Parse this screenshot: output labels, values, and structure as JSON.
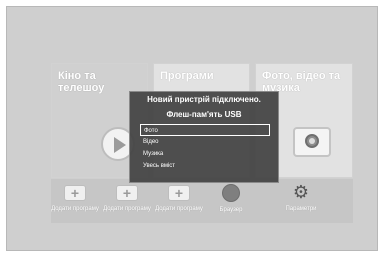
{
  "tiles": [
    {
      "title": "Кіно та телешоу"
    },
    {
      "title": "Програми"
    },
    {
      "title": "Фото, відео та музика"
    }
  ],
  "bottom_bar": {
    "items": [
      {
        "label": "Додати програму",
        "icon": "add-icon"
      },
      {
        "label": "Додати програму",
        "icon": "add-icon"
      },
      {
        "label": "Додати програму",
        "icon": "add-icon"
      },
      {
        "label": "Браузер",
        "icon": "globe-icon"
      },
      {
        "label": "Параметри",
        "icon": "gear-icon"
      }
    ]
  },
  "dialog": {
    "title": "Новий пристрій підключено.",
    "device": "Флеш-пам'ять USB",
    "options": [
      {
        "label": "Фото",
        "selected": true
      },
      {
        "label": "Відео",
        "selected": false
      },
      {
        "label": "Музика",
        "selected": false
      },
      {
        "label": "Увесь вміст",
        "selected": false
      }
    ]
  },
  "icons": {
    "play": "play-icon",
    "camera": "camera-icon"
  }
}
